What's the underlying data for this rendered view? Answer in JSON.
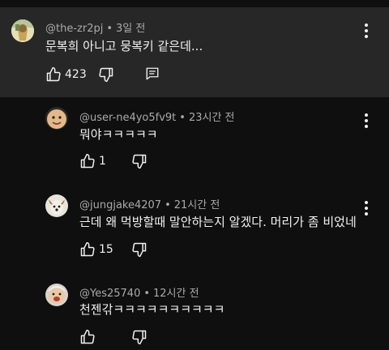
{
  "comments": [
    {
      "handle": "@the-zr2pj",
      "time": "3일 전",
      "text": "문복희 아니고 뭉복키 같은데...",
      "likes": "423",
      "reply_icon": "comment-reply-icon"
    },
    {
      "handle": "@user-ne4yo5fv9t",
      "time": "23시간 전",
      "text": "뭐야ㅋㅋㅋㅋㅋ",
      "likes": "1"
    },
    {
      "handle": "@jungjake4207",
      "time": "21시간 전",
      "text": "근데 왜 먹방할때 말안하는지 알겠다. 머리가 좀 비었네",
      "likes": "15"
    },
    {
      "handle": "@Yes25740",
      "time": "12시간 전",
      "text": "천젠갂ㅋㅋㅋㅋㅋㅋㅋㅋㅋㅋ",
      "likes": ""
    }
  ],
  "icons": {
    "like": "thumbs-up-icon",
    "dislike": "thumbs-down-icon",
    "more": "more-vertical-icon",
    "reply": "comment-reply-icon"
  },
  "colors": {
    "background": "#0f0f0f",
    "highlight": "#272727",
    "text": "#f1f1f1",
    "meta": "#aaaaaa"
  }
}
